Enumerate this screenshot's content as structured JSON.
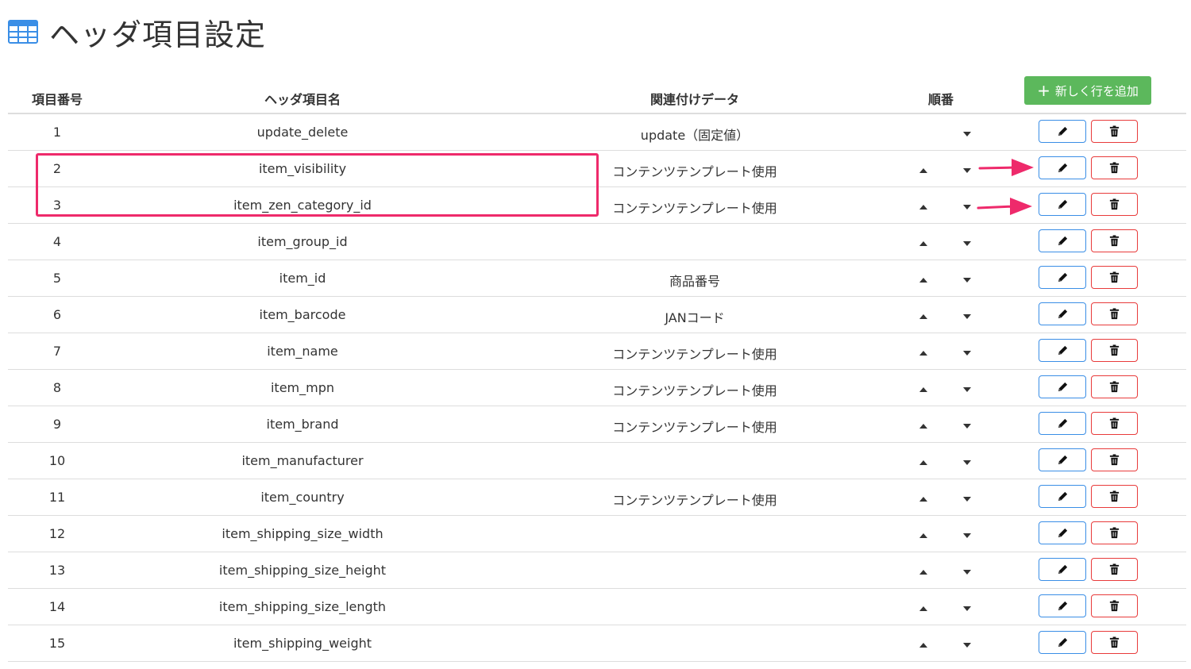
{
  "page": {
    "title": "ヘッダ項目設定",
    "title_icon": "table-icon",
    "accent_blue": "#3a8ee6",
    "accent_red": "#e83b3b",
    "accent_green": "#5cb85c",
    "annotation_color": "#ee2a6b"
  },
  "table": {
    "headers": {
      "num": "項目番号",
      "name": "ヘッダ項目名",
      "data": "関連付けデータ",
      "order": "順番"
    },
    "add_button_label": "新しく行を追加",
    "add_button_icon": "plus-icon",
    "rows": [
      {
        "num": "1",
        "name": "update_delete",
        "data": "update（固定値）"
      },
      {
        "num": "2",
        "name": "item_visibility",
        "data": "コンテンツテンプレート使用"
      },
      {
        "num": "3",
        "name": "item_zen_category_id",
        "data": "コンテンツテンプレート使用"
      },
      {
        "num": "4",
        "name": "item_group_id",
        "data": ""
      },
      {
        "num": "5",
        "name": "item_id",
        "data": "商品番号"
      },
      {
        "num": "6",
        "name": "item_barcode",
        "data": "JANコード"
      },
      {
        "num": "7",
        "name": "item_name",
        "data": "コンテンツテンプレート使用"
      },
      {
        "num": "8",
        "name": "item_mpn",
        "data": "コンテンツテンプレート使用"
      },
      {
        "num": "9",
        "name": "item_brand",
        "data": "コンテンツテンプレート使用"
      },
      {
        "num": "10",
        "name": "item_manufacturer",
        "data": ""
      },
      {
        "num": "11",
        "name": "item_country",
        "data": "コンテンツテンプレート使用"
      },
      {
        "num": "12",
        "name": "item_shipping_size_width",
        "data": ""
      },
      {
        "num": "13",
        "name": "item_shipping_size_height",
        "data": ""
      },
      {
        "num": "14",
        "name": "item_shipping_size_length",
        "data": ""
      },
      {
        "num": "15",
        "name": "item_shipping_weight",
        "data": ""
      }
    ]
  }
}
